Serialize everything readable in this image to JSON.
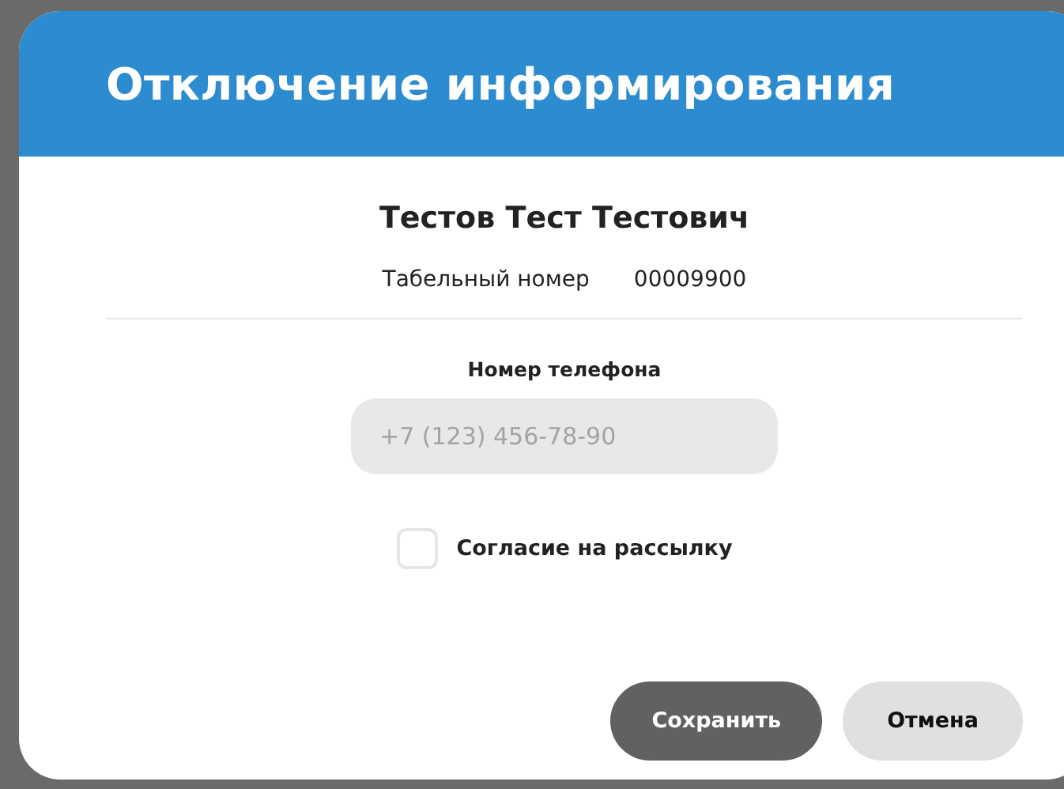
{
  "dialog": {
    "title": "Отключение информирования",
    "employee_name": "Тестов Тест Тестович",
    "id_label": "Табельный номер",
    "id_value": "00009900",
    "phone": {
      "label": "Номер телефона",
      "placeholder": "+7 (123) 456-78-90"
    },
    "consent": {
      "label": "Согласие на рассылку",
      "checked": false
    },
    "buttons": [
      {
        "label": "Сохранить",
        "kind": "primary"
      },
      {
        "label": "Отмена",
        "kind": "secondary"
      }
    ]
  }
}
